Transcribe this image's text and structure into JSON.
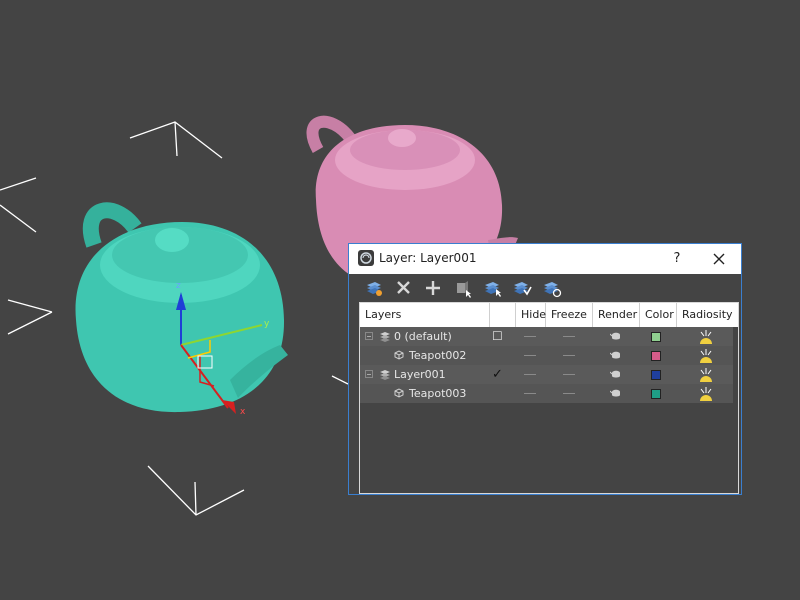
{
  "dialog": {
    "title": "Layer: Layer001",
    "help": "?",
    "toolbar": [
      {
        "icon": "create-layer-icon"
      },
      {
        "icon": "delete-icon"
      },
      {
        "icon": "add-icon"
      },
      {
        "icon": "select-objects-icon"
      },
      {
        "icon": "select-layer-icon"
      },
      {
        "icon": "set-current-layer-icon"
      },
      {
        "icon": "hide-freeze-layers-icon"
      }
    ],
    "columns": {
      "layers": "Layers",
      "hide": "Hide",
      "freeze": "Freeze",
      "render": "Render",
      "color": "Color",
      "radiosity": "Radiosity"
    },
    "rows": [
      {
        "name": "0 (default)",
        "type": "layer",
        "current": "☐",
        "color": "#8fcf8f"
      },
      {
        "name": "Teapot002",
        "type": "object",
        "current": "",
        "color": "#d65c8a"
      },
      {
        "name": "Layer001",
        "type": "layer",
        "current": "✓",
        "color": "#1f3f9e"
      },
      {
        "name": "Teapot003",
        "type": "object",
        "current": "",
        "color": "#1f9e86"
      }
    ]
  },
  "viewport": {
    "background": "#444444",
    "objects": [
      {
        "name": "teapot-teal",
        "color": "#3fc6b0"
      },
      {
        "name": "teapot-pink",
        "color": "#d98cb4"
      }
    ],
    "gizmo": {
      "x_label": "x",
      "y_label": "y",
      "z_label": "z"
    }
  }
}
